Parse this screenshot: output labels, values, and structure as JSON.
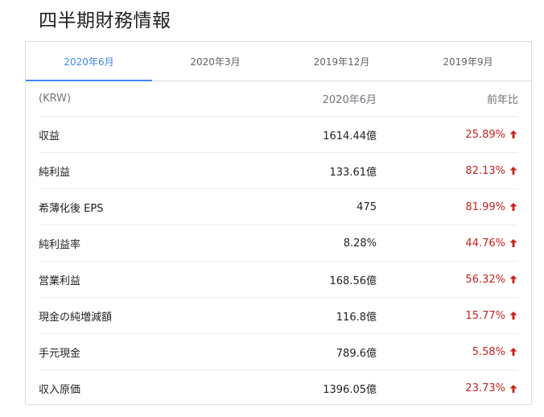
{
  "page_title": "四半期財務情報",
  "tabs": [
    {
      "label": "2020年6月",
      "active": true
    },
    {
      "label": "2020年3月",
      "active": false
    },
    {
      "label": "2019年12月",
      "active": false
    },
    {
      "label": "2019年9月",
      "active": false
    }
  ],
  "table": {
    "header": {
      "label": "(KRW)",
      "value": "2020年6月",
      "change": "前年比"
    },
    "rows": [
      {
        "label": "収益",
        "value": "1614.44億",
        "change": "25.89%",
        "direction": "up"
      },
      {
        "label": "純利益",
        "value": "133.61億",
        "change": "82.13%",
        "direction": "up"
      },
      {
        "label": "希薄化後 EPS",
        "value": "475",
        "change": "81.99%",
        "direction": "up"
      },
      {
        "label": "純利益率",
        "value": "8.28%",
        "change": "44.76%",
        "direction": "up"
      },
      {
        "label": "営業利益",
        "value": "168.56億",
        "change": "56.32%",
        "direction": "up"
      },
      {
        "label": "現金の純増減額",
        "value": "116.8億",
        "change": "15.77%",
        "direction": "up"
      },
      {
        "label": "手元現金",
        "value": "789.6億",
        "change": "5.58%",
        "direction": "up"
      },
      {
        "label": "収入原価",
        "value": "1396.05億",
        "change": "23.73%",
        "direction": "up"
      }
    ]
  },
  "colors": {
    "accent": "#4285f4",
    "positive_change": "#c5221f"
  },
  "icons": {
    "change_indicator": "arrow-up-icon"
  }
}
